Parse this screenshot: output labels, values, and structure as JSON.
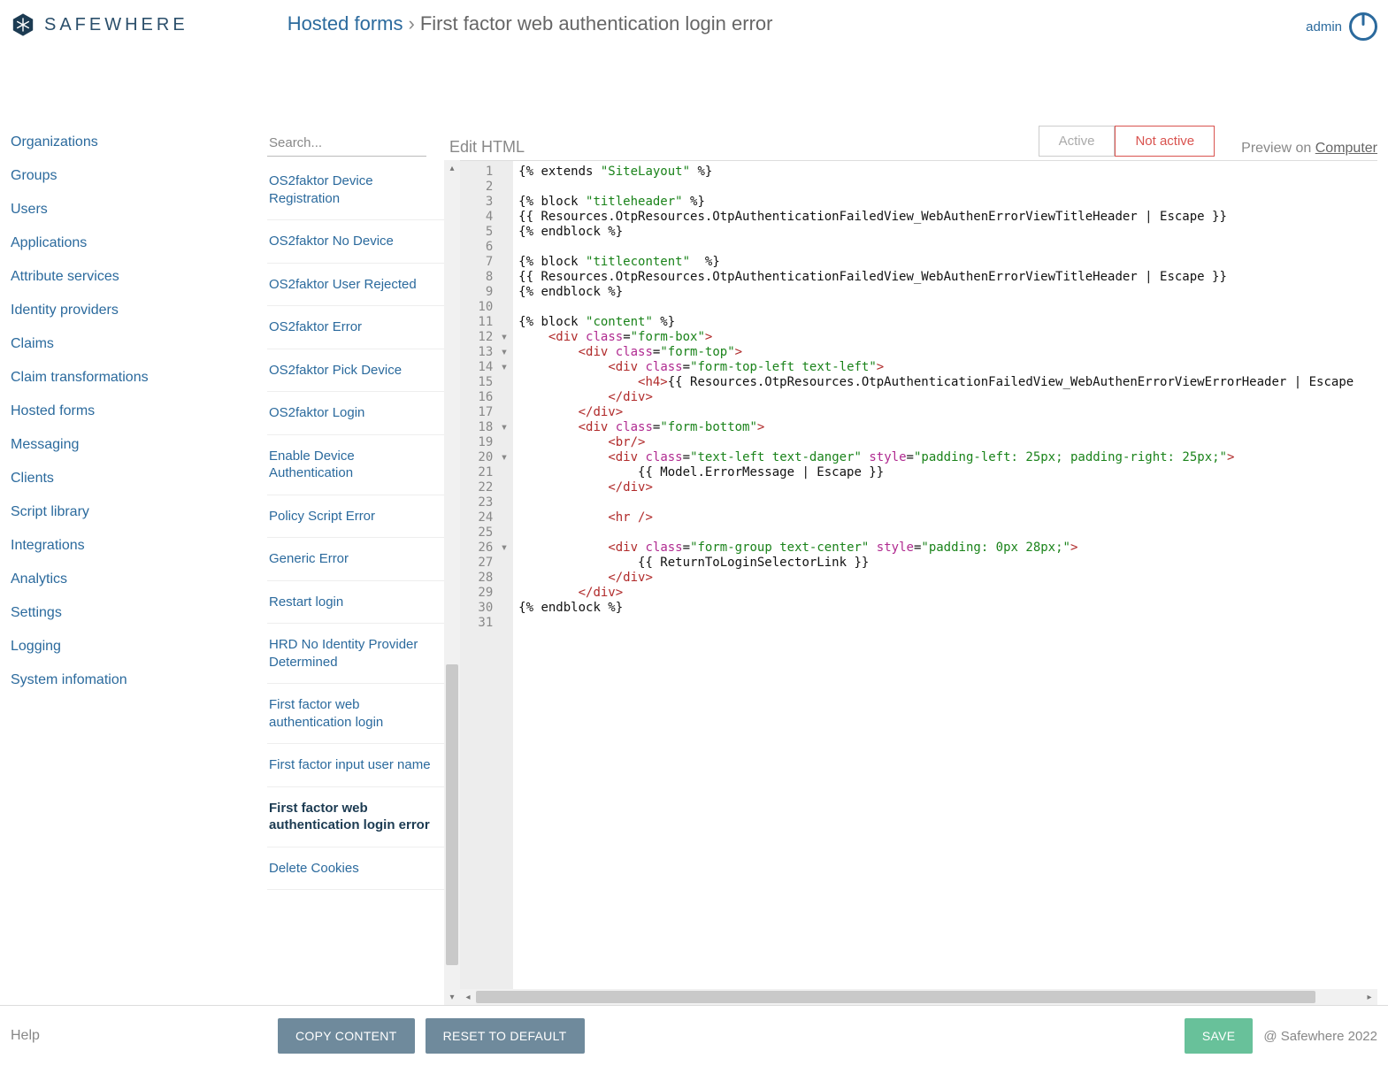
{
  "brand": {
    "text": "SAFEWHERE"
  },
  "breadcrumb": {
    "root": "Hosted forms",
    "sep": "›",
    "current": "First factor web authentication login error"
  },
  "user": {
    "name": "admin"
  },
  "nav": {
    "items": [
      "Organizations",
      "Groups",
      "Users",
      "Applications",
      "Attribute services",
      "Identity providers",
      "Claims",
      "Claim transformations",
      "Hosted forms",
      "Messaging",
      "Clients",
      "Script library",
      "Integrations",
      "Analytics",
      "Settings",
      "Logging",
      "System infomation"
    ]
  },
  "search": {
    "placeholder": "Search..."
  },
  "editorHeader": {
    "title": "Edit HTML"
  },
  "segmented": {
    "active": "Active",
    "notActive": "Not active",
    "selected": "notActive"
  },
  "preview": {
    "label": "Preview on ",
    "target": "Computer"
  },
  "templates": {
    "items": [
      "OS2faktor Device Registration",
      "OS2faktor No Device",
      "OS2faktor User Rejected",
      "OS2faktor Error",
      "OS2faktor Pick Device",
      "OS2faktor Login",
      "Enable Device Authentication",
      "Policy Script Error",
      "Generic Error",
      "Restart login",
      "HRD No Identity Provider Determined",
      "First factor web authentication login",
      "First factor input user name",
      "First factor web authentication login error",
      "Delete Cookies"
    ],
    "selectedIndex": 13
  },
  "code": {
    "lines": [
      {
        "n": 1,
        "h": "{% extends <span class=\"s\">\"SiteLayout\"</span> %}"
      },
      {
        "n": 2,
        "h": ""
      },
      {
        "n": 3,
        "h": "{% block <span class=\"s\">\"titleheader\"</span> %}"
      },
      {
        "n": 4,
        "h": "{{ Resources.OtpResources.OtpAuthenticationFailedView_WebAuthenErrorViewTitleHeader | Escape }}"
      },
      {
        "n": 5,
        "h": "{% endblock %}"
      },
      {
        "n": 6,
        "h": ""
      },
      {
        "n": 7,
        "h": "{% block <span class=\"s\">\"titlecontent\"</span>  %}"
      },
      {
        "n": 8,
        "h": "{{ Resources.OtpResources.OtpAuthenticationFailedView_WebAuthenErrorViewTitleHeader | Escape }}"
      },
      {
        "n": 9,
        "h": "{% endblock %}"
      },
      {
        "n": 10,
        "h": ""
      },
      {
        "n": 11,
        "h": "{% block <span class=\"s\">\"content\"</span> %}"
      },
      {
        "n": 12,
        "f": true,
        "h": "    <span class=\"t\">&lt;div</span> <span class=\"a\">class</span>=<span class=\"s\">\"form-box\"</span><span class=\"t\">&gt;</span>"
      },
      {
        "n": 13,
        "f": true,
        "h": "        <span class=\"t\">&lt;div</span> <span class=\"a\">class</span>=<span class=\"s\">\"form-top\"</span><span class=\"t\">&gt;</span>"
      },
      {
        "n": 14,
        "f": true,
        "h": "            <span class=\"t\">&lt;div</span> <span class=\"a\">class</span>=<span class=\"s\">\"form-top-left text-left\"</span><span class=\"t\">&gt;</span>"
      },
      {
        "n": 15,
        "h": "                <span class=\"t\">&lt;h4&gt;</span>{{ Resources.OtpResources.OtpAuthenticationFailedView_WebAuthenErrorViewErrorHeader | Escape"
      },
      {
        "n": 16,
        "h": "            <span class=\"t\">&lt;/div&gt;</span>"
      },
      {
        "n": 17,
        "h": "        <span class=\"t\">&lt;/div&gt;</span>"
      },
      {
        "n": 18,
        "f": true,
        "h": "        <span class=\"t\">&lt;div</span> <span class=\"a\">class</span>=<span class=\"s\">\"form-bottom\"</span><span class=\"t\">&gt;</span>"
      },
      {
        "n": 19,
        "h": "            <span class=\"t\">&lt;br/&gt;</span>"
      },
      {
        "n": 20,
        "f": true,
        "h": "            <span class=\"t\">&lt;div</span> <span class=\"a\">class</span>=<span class=\"s\">\"text-left text-danger\"</span> <span class=\"a\">style</span>=<span class=\"s\">\"padding-left: 25px; padding-right: 25px;\"</span><span class=\"t\">&gt;</span>"
      },
      {
        "n": 21,
        "h": "                {{ Model.ErrorMessage | Escape }}"
      },
      {
        "n": 22,
        "h": "            <span class=\"t\">&lt;/div&gt;</span>"
      },
      {
        "n": 23,
        "h": ""
      },
      {
        "n": 24,
        "h": "            <span class=\"t\">&lt;hr /&gt;</span>"
      },
      {
        "n": 25,
        "h": ""
      },
      {
        "n": 26,
        "f": true,
        "h": "            <span class=\"t\">&lt;div</span> <span class=\"a\">class</span>=<span class=\"s\">\"form-group text-center\"</span> <span class=\"a\">style</span>=<span class=\"s\">\"padding: 0px 28px;\"</span><span class=\"t\">&gt;</span>"
      },
      {
        "n": 27,
        "h": "                {{ ReturnToLoginSelectorLink }}"
      },
      {
        "n": 28,
        "h": "            <span class=\"t\">&lt;/div&gt;</span>"
      },
      {
        "n": 29,
        "h": "        <span class=\"t\">&lt;/div&gt;</span>"
      },
      {
        "n": 30,
        "h": "{% endblock %}"
      },
      {
        "n": 31,
        "h": "",
        "cursor": true
      }
    ]
  },
  "footer": {
    "help": "Help",
    "copy": "COPY CONTENT",
    "reset": "RESET TO DEFAULT",
    "save": "SAVE",
    "copyright": "@ Safewhere 2022"
  }
}
